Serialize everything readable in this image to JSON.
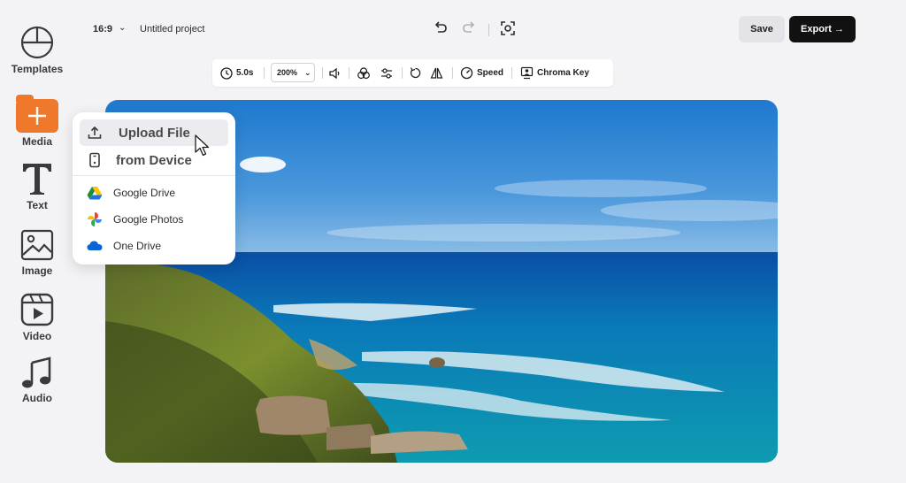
{
  "sidebar": {
    "items": [
      {
        "label": "Templates",
        "icon": "templates-icon"
      },
      {
        "label": "Media",
        "icon": "plus-icon"
      },
      {
        "label": "Text",
        "icon": "text-icon"
      },
      {
        "label": "Image",
        "icon": "image-icon"
      },
      {
        "label": "Video",
        "icon": "video-icon"
      },
      {
        "label": "Audio",
        "icon": "music-note-icon"
      }
    ]
  },
  "topbar": {
    "aspect_ratio": "16:9",
    "project_name": "Untitled project",
    "save_label": "Save",
    "export_label": "Export →"
  },
  "toolbar": {
    "duration": "5.0s",
    "zoom": "200%",
    "speed_label": "Speed",
    "chroma_key_label": "Chroma Key"
  },
  "upload_menu": {
    "upload_file": "Upload File",
    "from_device": "from Device",
    "google_drive": "Google Drive",
    "google_photos": "Google Photos",
    "one_drive": "One Drive"
  },
  "colors": {
    "accent": "#f0782a",
    "export_bg": "#111111",
    "background": "#f3f3f5"
  }
}
